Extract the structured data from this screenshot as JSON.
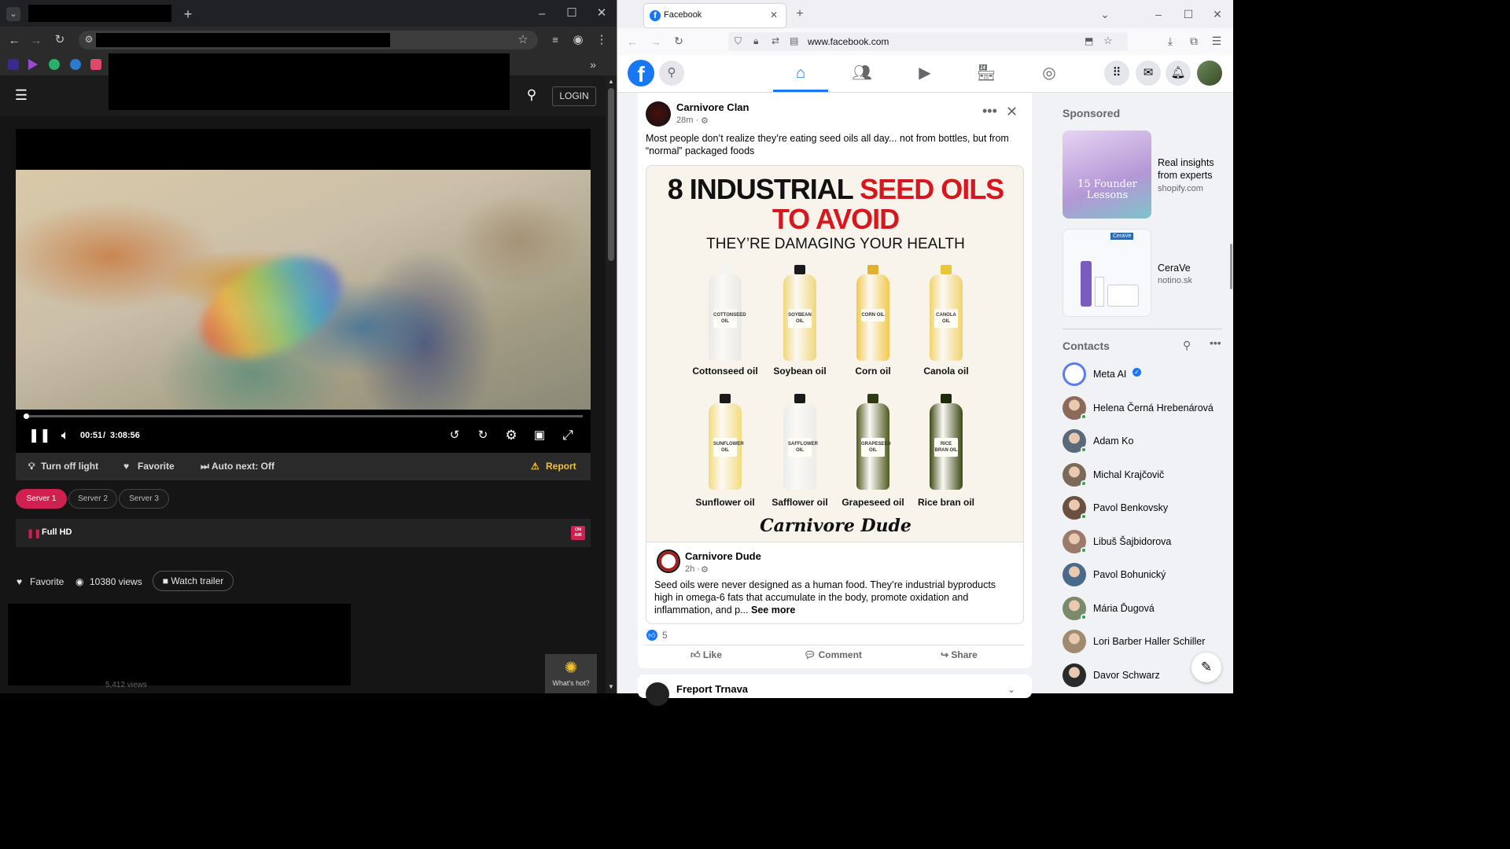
{
  "left_browser": {
    "tab_title": "",
    "new_tab_symbol": "+",
    "site": {
      "login_label": "LOGIN"
    },
    "player": {
      "current_time": "00:51",
      "separator": "/",
      "duration": "3:08:56",
      "progress_fraction": 0.0045
    },
    "actions": {
      "light": "Turn off light",
      "favorite": "Favorite",
      "auto_next": "Auto next: Off",
      "report": "Report"
    },
    "servers": [
      "Server 1",
      "Server 2",
      "Server 3"
    ],
    "quality": {
      "label": "Full HD",
      "badge_line1": "ON",
      "badge_line2": "AIR"
    },
    "meta": {
      "favorite": "Favorite",
      "views": "10380 views",
      "trailer": "Watch trailer"
    },
    "below_views": "5,412 views",
    "whats_hot": "What's hot?"
  },
  "right_browser": {
    "tab_title": "Facebook",
    "url": "www.facebook.com",
    "post": {
      "author": "Carnivore Clan",
      "time": "28m ·",
      "text": "Most people don’t realize they’re eating seed oils all day... not from bottles, but from “normal” packaged foods",
      "infographic": {
        "title_black": "8 INDUSTRIAL",
        "title_red_1": "SEED OILS",
        "title_red_2": "TO AVOID",
        "subtitle": "THEY’RE DAMAGING YOUR HEALTH",
        "oils": [
          {
            "name": "Cottonseed oil",
            "label": "COTTONSEED OIL",
            "color": "#e9e9e6",
            "cap": "#f4f4f4"
          },
          {
            "name": "Soybean oil",
            "label": "SOYBEAN OIL",
            "color": "#f0d77a",
            "cap": "#1a1a1a"
          },
          {
            "name": "Corn oil",
            "label": "CORN OIL",
            "color": "#f2c94c",
            "cap": "#e0b030"
          },
          {
            "name": "Canola oil",
            "label": "CANOLA OIL",
            "color": "#f1d36a",
            "cap": "#e9c53c"
          },
          {
            "name": "Sunflower oil",
            "label": "SUNFLOWER OIL",
            "color": "#f2dc7c",
            "cap": "#1a1a1a"
          },
          {
            "name": "Safflower oil",
            "label": "SAFFLOWER OIL",
            "color": "#ececea",
            "cap": "#1a1a1a"
          },
          {
            "name": "Grapeseed oil",
            "label": "GRAPESEED OIL",
            "color": "#4f5a1e",
            "cap": "#2e3a10"
          },
          {
            "name": "Rice bran oil",
            "label": "RICE BRAN OIL",
            "color": "#3c4a14",
            "cap": "#1e2a08"
          }
        ],
        "signature": "Carnivore Dude"
      },
      "shared": {
        "author": "Carnivore Dude",
        "time": "2h ·",
        "text": "Seed oils were never designed as a human food. They’re industrial byproducts high in omega-6 fats that accumulate in the body, promote oxidation and inflammation, and p...",
        "see_more": "See more"
      },
      "reactions_count": "5",
      "like": "Like",
      "comment": "Comment",
      "share": "Share"
    },
    "next_post_author": "Freport Trnava",
    "sponsored": {
      "heading": "Sponsored",
      "ads": [
        {
          "title": "Real insights from experts",
          "domain": "shopify.com",
          "image_text": "15 Founder Lessons"
        },
        {
          "title": "CeraVe",
          "domain": "notino.sk",
          "image_text": "CeraVe"
        }
      ]
    },
    "contacts": {
      "heading": "Contacts",
      "items": [
        {
          "name": "Meta AI",
          "online": false,
          "color": "#e8eaff"
        },
        {
          "name": "Helena Černá Hrebenárová",
          "online": true,
          "color": "#8a6a5a"
        },
        {
          "name": "Adam Ko",
          "online": true,
          "color": "#5a6a7a"
        },
        {
          "name": "Michal Krajčovič",
          "online": true,
          "color": "#7a6a5a"
        },
        {
          "name": "Pavol Benkovsky",
          "online": true,
          "color": "#6a5040"
        },
        {
          "name": "Libuš Šajbidorova",
          "online": true,
          "color": "#9a7a6a"
        },
        {
          "name": "Pavol Bohunický",
          "online": false,
          "color": "#4a6a8a"
        },
        {
          "name": "Mária Ďugová",
          "online": true,
          "color": "#7a8a6a"
        },
        {
          "name": "Lori Barber Haller Schiller",
          "online": false,
          "color": "#a08a70"
        },
        {
          "name": "Davor Schwarz",
          "online": false,
          "color": "#2a2a2a"
        }
      ]
    }
  }
}
